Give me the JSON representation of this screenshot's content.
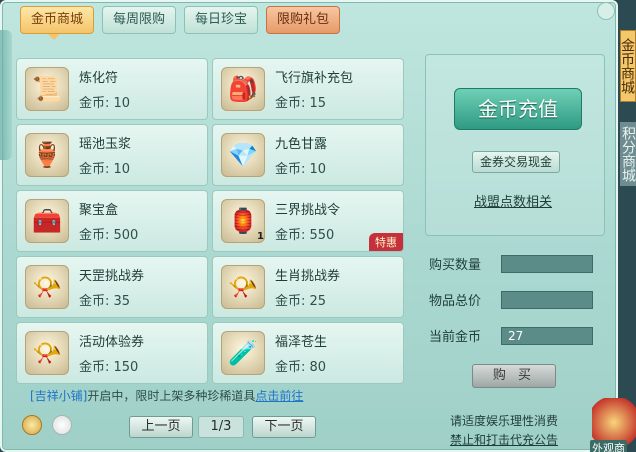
{
  "tabs": [
    {
      "label": "金币商城",
      "active": true
    },
    {
      "label": "每周限购",
      "active": false
    },
    {
      "label": "每日珍宝",
      "active": false
    },
    {
      "label": "限购礼包",
      "active": false
    }
  ],
  "items": [
    {
      "name": "炼化符",
      "price": "金币: 10",
      "icon": "talisman-icon"
    },
    {
      "name": "飞行旗补充包",
      "price": "金币: 15",
      "icon": "flag-pack-icon"
    },
    {
      "name": "瑶池玉浆",
      "price": "金币: 10",
      "icon": "jade-jar-icon"
    },
    {
      "name": "九色甘露",
      "price": "金币: 10",
      "icon": "dew-gem-icon"
    },
    {
      "name": "聚宝盒",
      "price": "金币: 500",
      "icon": "treasure-box-icon"
    },
    {
      "name": "三界挑战令",
      "price": "金币: 550",
      "icon": "challenge-token-icon",
      "qty": "1",
      "badge": "特惠"
    },
    {
      "name": "天罡挑战券",
      "price": "金币: 35",
      "icon": "scroll-icon"
    },
    {
      "name": "生肖挑战券",
      "price": "金币: 25",
      "icon": "scroll-icon"
    },
    {
      "name": "活动体验券",
      "price": "金币: 150",
      "icon": "scroll-icon"
    },
    {
      "name": "福泽苍生",
      "price": "金币: 80",
      "icon": "potion-icon"
    }
  ],
  "promo": {
    "shop": "[吉祥小铺]",
    "text": "开启中，限时上架多种珍稀道具",
    "link": "点击前往"
  },
  "pager": {
    "prev": "上一页",
    "page": "1/3",
    "next": "下一页"
  },
  "right": {
    "recharge": "金币充值",
    "exchange": "金券交易现金",
    "league": "战盟点数相关",
    "buy_qty_label": "购买数量",
    "total_label": "物品总价",
    "current_label": "当前金币",
    "current_value": "27",
    "buy": "购 买",
    "notice1": "请适度娱乐理性消费",
    "notice2": "禁止和打击代充公告"
  },
  "side": {
    "tab1": "金币商城",
    "tab2": "积分商城"
  },
  "corner_label": "外观商"
}
